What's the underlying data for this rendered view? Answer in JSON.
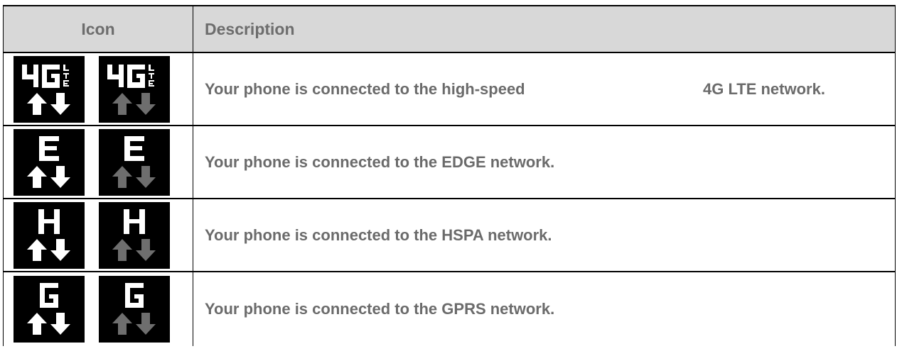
{
  "header": {
    "icon_label": "Icon",
    "description_label": "Description"
  },
  "rows": [
    {
      "network": "4G LTE",
      "description_main": "Your phone is connected to the high-speed",
      "description_tail": "4G LTE network.",
      "icons": [
        "4g-lte-active-icon",
        "4g-lte-idle-icon"
      ]
    },
    {
      "network": "EDGE",
      "description_main": "Your phone is connected to the EDGE network.",
      "icons": [
        "edge-active-icon",
        "edge-idle-icon"
      ]
    },
    {
      "network": "HSPA",
      "description_main": "Your phone is connected to the HSPA network.",
      "icons": [
        "hspa-active-icon",
        "hspa-idle-icon"
      ]
    },
    {
      "network": "GPRS",
      "description_main": "Your phone is connected to the GPRS network.",
      "icons": [
        "gprs-active-icon",
        "gprs-idle-icon"
      ]
    }
  ],
  "colors": {
    "header_bg": "#d8d8d8",
    "text": "#6b6b6b",
    "icon_bg": "#000000",
    "arrow_active": "#ffffff",
    "arrow_idle": "#6e6e6e"
  }
}
